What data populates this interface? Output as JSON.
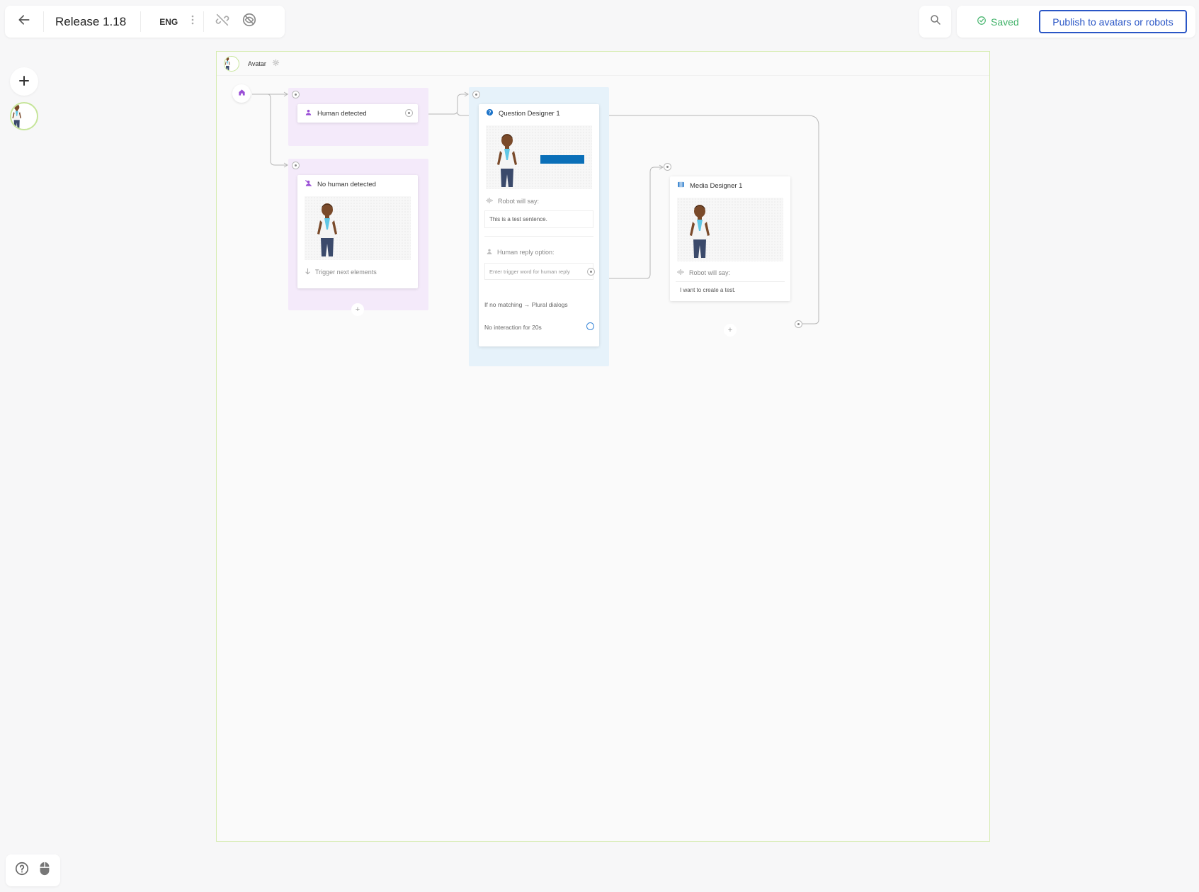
{
  "toolbar": {
    "title": "Release 1.18",
    "language": "ENG",
    "saved_label": "Saved",
    "publish_label": "Publish to avatars or robots"
  },
  "canvas": {
    "avatar_label": "Avatar",
    "human_detected": {
      "title": "Human detected"
    },
    "no_human_detected": {
      "title": "No human detected",
      "trigger_label": "Trigger next elements"
    },
    "question_designer": {
      "title": "Question Designer 1",
      "robot_will_say_label": "Robot will say:",
      "robot_text": "This is a test sentence.",
      "human_reply_label": "Human reply option:",
      "reply_placeholder": "Enter trigger word for human reply",
      "no_matching_label": "If no matching → Plural dialogs",
      "no_interaction_label": "No interaction for 20s"
    },
    "media_designer": {
      "title": "Media Designer 1",
      "robot_will_say_label": "Robot will say:",
      "robot_text": "I want to create a test."
    }
  },
  "colors": {
    "accent_blue": "#2a56c6",
    "saved_green": "#42b36a",
    "purple_group": "#f4eafa",
    "blue_group": "#e6f2fa",
    "frame_border": "#d6ecb0",
    "preview_bar": "#0a6fb8"
  },
  "icons": {
    "back": "arrow-left-icon",
    "kebab": "more-vertical-icon",
    "link_off": "link-off-icon",
    "eye_off": "eye-off-icon",
    "search": "search-icon",
    "saved": "check-circle-icon",
    "add": "plus-icon",
    "help": "help-circle-icon",
    "mouse": "mouse-icon",
    "home": "home-icon",
    "person": "person-icon",
    "no_person": "person-off-icon",
    "question": "question-circle-icon",
    "media": "media-icon",
    "sound": "sound-wave-icon",
    "settings": "gear-icon"
  }
}
